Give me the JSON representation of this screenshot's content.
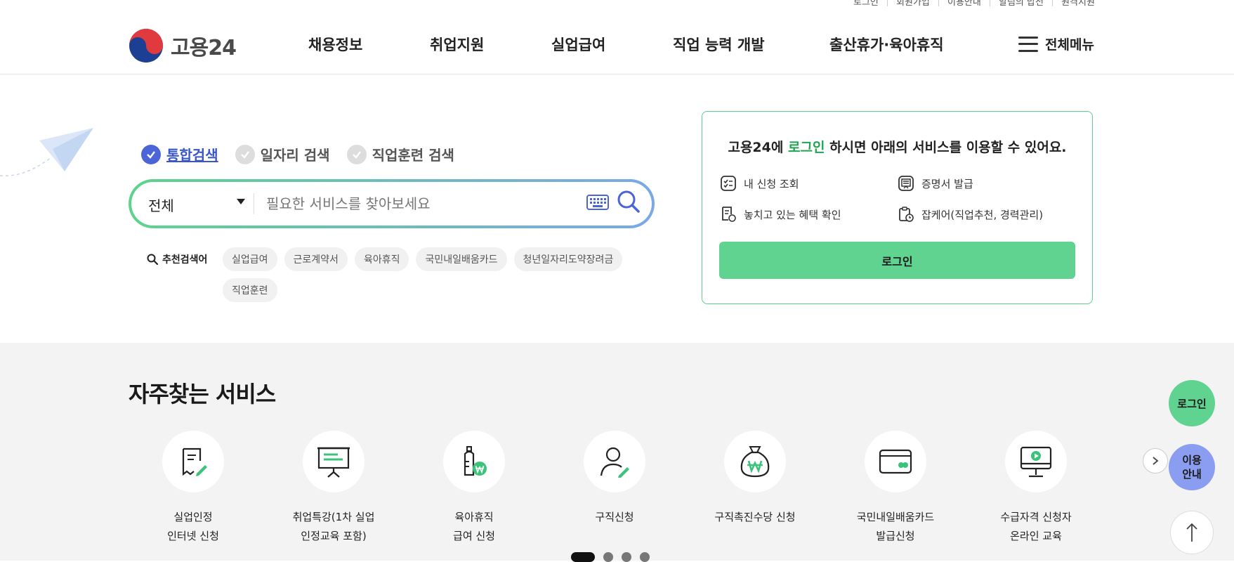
{
  "header": {
    "util_links": [
      "로그인",
      "회원가입",
      "이용안내",
      "알림의 밥전",
      "원격지원"
    ],
    "logo_text": "고용24",
    "nav": [
      "채용정보",
      "취업지원",
      "실업급여",
      "직업 능력 개발",
      "출산휴가·육아휴직"
    ],
    "all_menu": "전체메뉴"
  },
  "search": {
    "tabs": [
      "통합검색",
      "일자리 검색",
      "직업훈련 검색"
    ],
    "active_tab": 0,
    "category_selected": "전체",
    "placeholder": "필요한 서비스를 찾아보세요",
    "recommend_title": "추천검색어",
    "keywords": [
      "실업급여",
      "근로계약서",
      "육아휴직",
      "국민내일배움카드",
      "청년일자리도약장려금",
      "직업훈련"
    ]
  },
  "login_card": {
    "title_prefix": "고용24에",
    "title_highlight": "로그인",
    "title_suffix": "하시면 아래의 서비스를 이용할 수 있어요.",
    "items": [
      "내 신청 조회",
      "증명서 발급",
      "놓치고 있는 혜택 확인",
      "잡케어(직업추천, 경력관리)"
    ],
    "button": "로그인"
  },
  "frequent": {
    "title": "자주찾는 서비스",
    "items": [
      {
        "line1": "실업인정",
        "line2": "인터넷 신청",
        "icon": "document-pen-icon"
      },
      {
        "line1": "취업특강(1차 실업",
        "line2": "인정교육 포함)",
        "icon": "presentation-board-icon"
      },
      {
        "line1": "육아휴직",
        "line2": "급여 신청",
        "icon": "baby-bottle-icon"
      },
      {
        "line1": "구직신청",
        "line2": "",
        "icon": "person-pen-icon"
      },
      {
        "line1": "구직촉진수당 신청",
        "line2": "",
        "icon": "money-bag-icon"
      },
      {
        "line1": "국민내일배움카드",
        "line2": "발급신청",
        "icon": "card-icon"
      },
      {
        "line1": "수급자격 신청자",
        "line2": "온라인 교육",
        "icon": "monitor-play-icon"
      }
    ],
    "pager_count": 4,
    "pager_active": 0
  },
  "floating": {
    "login": "로그인",
    "guide_line1": "이용",
    "guide_line2": "안내"
  },
  "colors": {
    "brand_green": "#5fd38f",
    "highlight_green": "#22a454",
    "active_blue": "#4b65d8",
    "guide_blue": "#8a9df0"
  }
}
